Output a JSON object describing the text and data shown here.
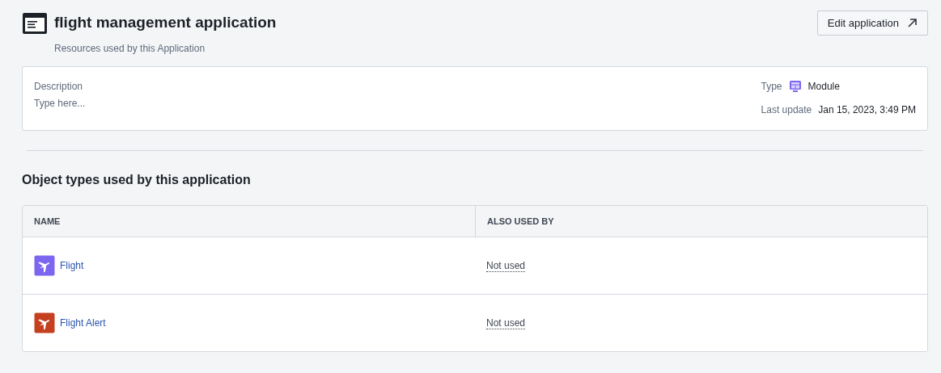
{
  "header": {
    "title": "flight management application",
    "subtitle": "Resources used by this Application",
    "edit_button": "Edit application"
  },
  "details": {
    "description_label": "Description",
    "description": {
      "placeholder": "Type here..."
    },
    "type_label": "Type",
    "type_value": "Module",
    "last_update_label": "Last update",
    "last_update_value": "Jan 15, 2023, 3:49 PM"
  },
  "section_title": "Object types used by this application",
  "table": {
    "columns": [
      "NAME",
      "ALSO USED BY"
    ],
    "rows": [
      {
        "name": "Flight",
        "color": "#7c66f0",
        "also_used_by": "Not used"
      },
      {
        "name": "Flight Alert",
        "color": "#c4401f",
        "also_used_by": "Not used"
      }
    ]
  }
}
